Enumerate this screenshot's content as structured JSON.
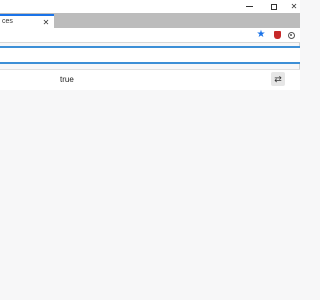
{
  "window": {
    "minimize_glyph": "",
    "maximize_glyph": "",
    "close_glyph": "✕"
  },
  "tab": {
    "title": "ces",
    "close_glyph": "✕"
  },
  "toolbar": {
    "star_glyph": "★",
    "icons": [
      "star-icon",
      "extension-icon",
      "profile-icon"
    ]
  },
  "filter": {
    "value": "",
    "placeholder": ""
  },
  "list": {
    "rows": [
      {
        "value": "true",
        "action_glyph": "⇄"
      }
    ]
  },
  "colors": {
    "accent": "#1a73e8",
    "filter_border": "#3d8fd6",
    "extension": "#c62828"
  }
}
